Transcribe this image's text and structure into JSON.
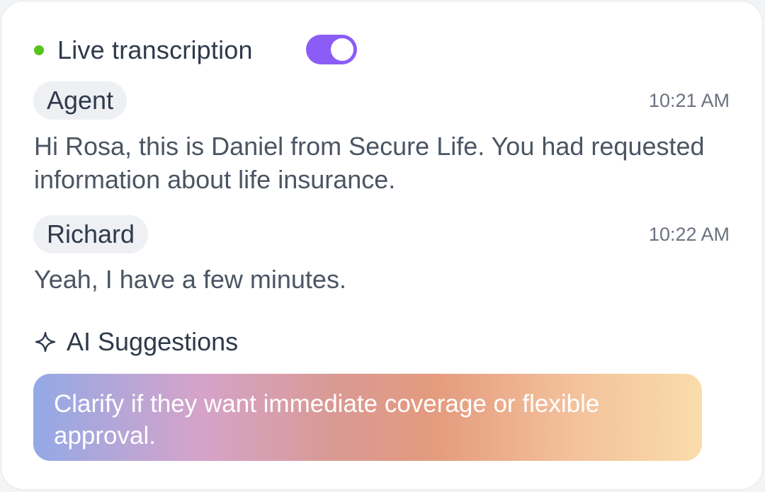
{
  "header": {
    "title": "Live transcription",
    "toggle_on": true,
    "status_color": "#56c31e",
    "toggle_color": "#8b5cf6"
  },
  "transcript": [
    {
      "speaker": "Agent",
      "time": "10:21 AM",
      "text": "Hi Rosa, this is Daniel from Secure Life. You had requested information about life insurance."
    },
    {
      "speaker": "Richard",
      "time": "10:22 AM",
      "text": "Yeah, I have a few minutes."
    }
  ],
  "ai": {
    "title": "AI Suggestions",
    "icon": "sparkle-icon",
    "suggestion": "Clarify if they want immediate coverage or flexible approval."
  }
}
